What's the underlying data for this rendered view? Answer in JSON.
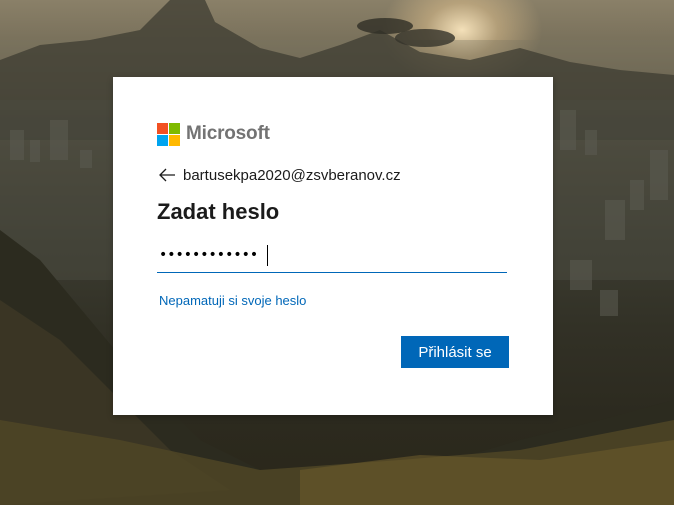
{
  "brand": {
    "name": "Microsoft",
    "logo_colors": [
      "#f25022",
      "#7fba00",
      "#00a4ef",
      "#ffb900"
    ]
  },
  "identity": {
    "back_icon": "arrow-left-icon",
    "email": "bartusekpa2020@zsvberanov.cz"
  },
  "heading": "Zadat heslo",
  "password": {
    "value": "••••••••••••",
    "masked_length": 12
  },
  "forgot_link": "Nepamatuji si svoje heslo",
  "submit_button": "Přihlásit se",
  "colors": {
    "accent": "#0067b8",
    "text": "#1b1b1b"
  }
}
